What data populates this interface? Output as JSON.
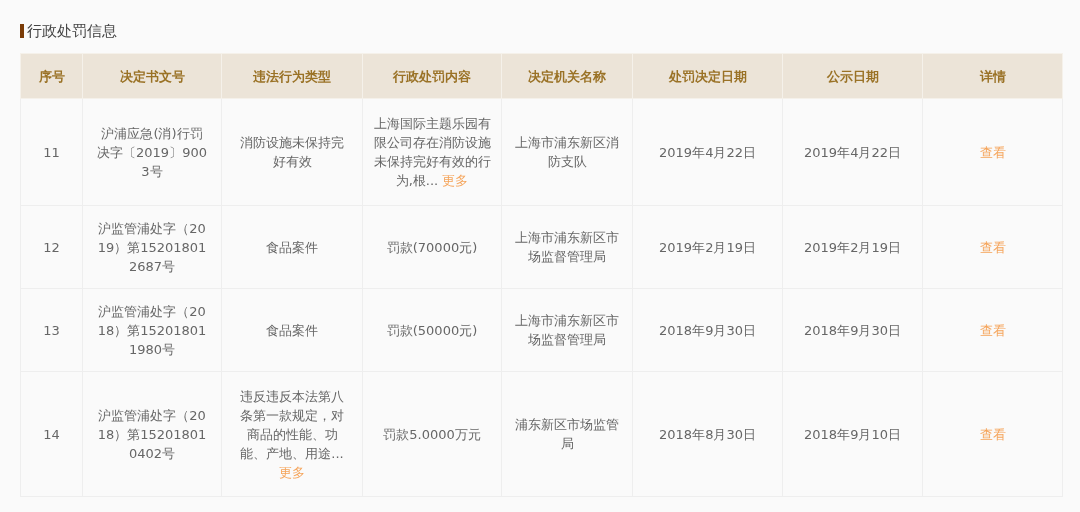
{
  "section_title": "行政处罚信息",
  "columns": [
    "序号",
    "决定书文号",
    "违法行为类型",
    "行政处罚内容",
    "决定机关名称",
    "处罚决定日期",
    "公示日期",
    "详情"
  ],
  "rows": [
    {
      "index": "11",
      "doc_no": "沪浦应急(消)行罚决字〔2019〕9003号",
      "violation": {
        "text": "消防设施未保持完好有效"
      },
      "penalty": {
        "text": "上海国际主题乐园有限公司存在消防设施未保持完好有效的行为,根...",
        "more": "更多"
      },
      "authority": "上海市浦东新区消防支队",
      "decision_date": "2019年4月22日",
      "publish_date": "2019年4月22日",
      "detail": "查看"
    },
    {
      "index": "12",
      "doc_no": "沪监管浦处字（2019）第152018012687号",
      "violation": {
        "text": "食品案件"
      },
      "penalty": {
        "text": "罚款(70000元)"
      },
      "authority": "上海市浦东新区市场监督管理局",
      "decision_date": "2019年2月19日",
      "publish_date": "2019年2月19日",
      "detail": "查看"
    },
    {
      "index": "13",
      "doc_no": "沪监管浦处字（2018）第152018011980号",
      "violation": {
        "text": "食品案件"
      },
      "penalty": {
        "text": "罚款(50000元)"
      },
      "authority": "上海市浦东新区市场监督管理局",
      "decision_date": "2018年9月30日",
      "publish_date": "2018年9月30日",
      "detail": "查看"
    },
    {
      "index": "14",
      "doc_no": "沪监管浦处字（2018）第152018010402号",
      "violation": {
        "text": "违反违反本法第八条第一款规定，对商品的性能、功能、产地、用途...",
        "more": "更多"
      },
      "penalty": {
        "text": "罚款5.0000万元"
      },
      "authority": "浦东新区市场监管局",
      "decision_date": "2018年8月30日",
      "publish_date": "2018年9月10日",
      "detail": "查看"
    }
  ]
}
